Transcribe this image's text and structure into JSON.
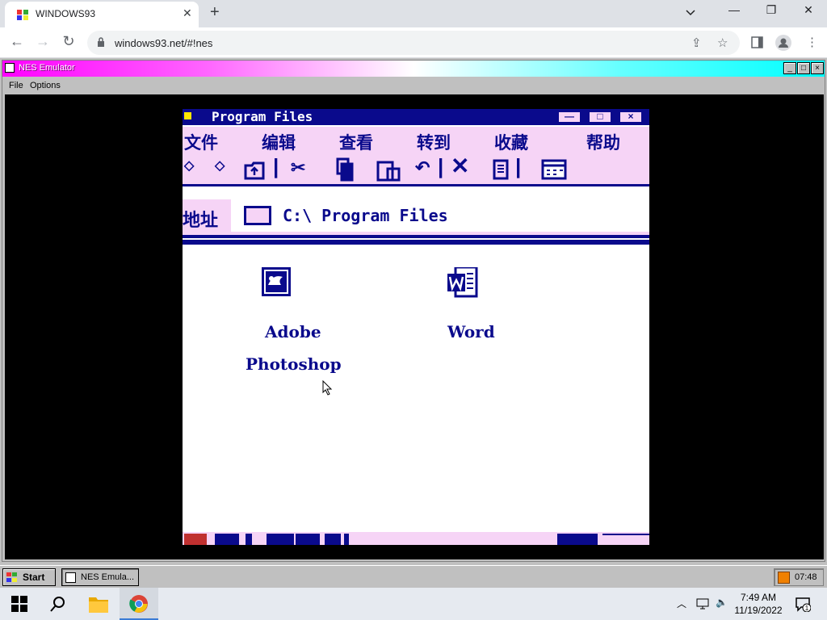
{
  "browser": {
    "tab_title": "WINDOWS93",
    "tab_close": "✕",
    "new_tab": "+",
    "url": "windows93.net/#!nes",
    "win_minimize": "—",
    "win_restore": "❐",
    "win_close": "✕"
  },
  "nes_window": {
    "title": "NES Emulator",
    "menu": [
      "File",
      "Options"
    ],
    "btn_min": "_",
    "btn_max": "□",
    "btn_close": "×"
  },
  "game": {
    "window_title": "Program Files",
    "menu": [
      "文件",
      "编辑",
      "查看",
      "转到",
      "收藏",
      "帮助"
    ],
    "address_label": "地址",
    "address_path": "C:\\ Program Files",
    "files": [
      {
        "label_line1": "Adobe",
        "label_line2": "Photoshop",
        "icon": "photoshop-icon"
      },
      {
        "label_line1": "Word",
        "icon": "word-icon"
      }
    ]
  },
  "w93_taskbar": {
    "start_label": "Start",
    "task_label": "NES Emula...",
    "tray_time": "07:48"
  },
  "os_taskbar": {
    "time": "7:49 AM",
    "date": "11/19/2022",
    "notification_count": "1"
  },
  "colors": {
    "game_blue": "#0a0a8c",
    "game_pink": "#f6d4f6",
    "nes_title_gradient": [
      "#ff00ff",
      "#ffffff",
      "#00ffff"
    ]
  }
}
